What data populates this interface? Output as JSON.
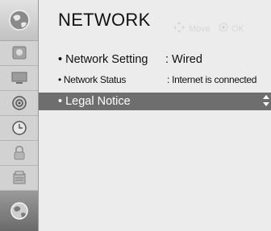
{
  "header": {
    "title": "NETWORK",
    "hint_move": "Move",
    "hint_ok": "OK"
  },
  "sidebar": {
    "icons": [
      "globe-icon",
      "picture-icon",
      "monitor-icon",
      "audio-icon",
      "clock-icon",
      "lock-icon",
      "options-icon",
      "network-globe-icon"
    ],
    "active": "network-globe-icon"
  },
  "menu": {
    "items": [
      {
        "label": "• Network Setting",
        "value": ": Wired"
      },
      {
        "label": "• Network Status",
        "value": ": Internet is connected"
      },
      {
        "label": "• Legal Notice",
        "value": ""
      }
    ],
    "selected": "• Legal Notice"
  },
  "colors": {
    "background": "#ececec",
    "sidebar": "#d2d2d2",
    "selected_row": "#6e6e6e"
  }
}
